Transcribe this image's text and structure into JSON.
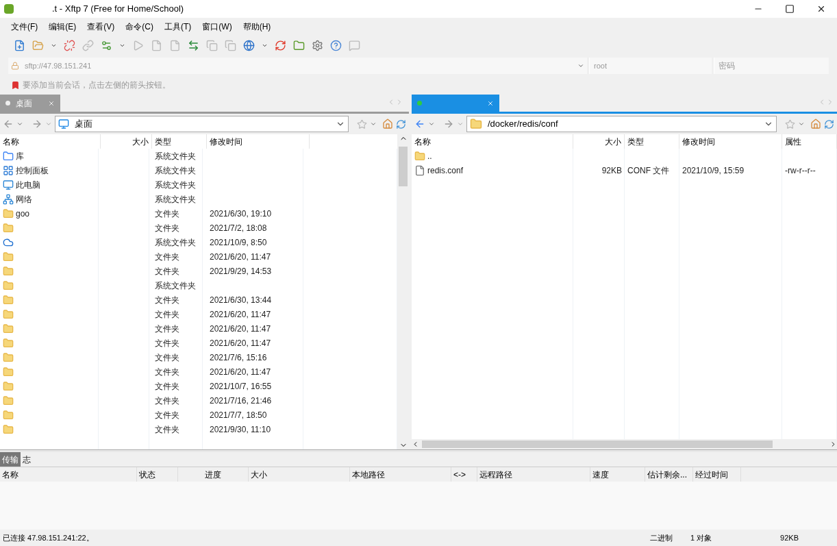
{
  "window": {
    "title": ".t - Xftp 7 (Free for Home/School)"
  },
  "menu": [
    "文件(F)",
    "编辑(E)",
    "查看(V)",
    "命令(C)",
    "工具(T)",
    "窗口(W)",
    "帮助(H)"
  ],
  "address_bar": {
    "host": {
      "placeholder": "sftp://47.98.151.241"
    },
    "user": {
      "placeholder": "root"
    },
    "password": {
      "placeholder": "密码"
    }
  },
  "hint": "要添加当前会话，点击左侧的箭头按钮。",
  "local": {
    "tab": {
      "label": "桌面",
      "selected": false
    },
    "path": "桌面",
    "columns": [
      "名称",
      "大小",
      "类型",
      "修改时间"
    ],
    "rows": [
      {
        "kind": "library",
        "name": "库",
        "type": "系统文件夹"
      },
      {
        "kind": "control",
        "name": "控制面板",
        "type": "系统文件夹"
      },
      {
        "kind": "computer",
        "name": "此电脑",
        "type": "系统文件夹"
      },
      {
        "kind": "network",
        "name": "网络",
        "type": "系统文件夹"
      },
      {
        "kind": "folder",
        "name": "goo",
        "type": "文件夹",
        "modified": "2021/6/30, 19:10"
      },
      {
        "kind": "folder",
        "type": "文件夹",
        "modified": "2021/7/2, 18:08"
      },
      {
        "kind": "cloud",
        "type": "系统文件夹",
        "modified": "2021/10/9, 8:50"
      },
      {
        "kind": "folder",
        "type": "文件夹",
        "modified": "2021/6/20, 11:47"
      },
      {
        "kind": "folder",
        "type": "文件夹",
        "modified": "2021/9/29, 14:53"
      },
      {
        "kind": "folder",
        "type": "系统文件夹"
      },
      {
        "kind": "folder",
        "type": "文件夹",
        "modified": "2021/6/30, 13:44"
      },
      {
        "kind": "folder",
        "type": "文件夹",
        "modified": "2021/6/20, 11:47"
      },
      {
        "kind": "folder",
        "type": "文件夹",
        "modified": "2021/6/20, 11:47"
      },
      {
        "kind": "folder",
        "type": "文件夹",
        "modified": "2021/6/20, 11:47"
      },
      {
        "kind": "folder",
        "type": "文件夹",
        "modified": "2021/7/6, 15:16"
      },
      {
        "kind": "folder",
        "type": "文件夹",
        "modified": "2021/6/20, 11:47"
      },
      {
        "kind": "folder",
        "type": "文件夹",
        "modified": "2021/10/7, 16:55"
      },
      {
        "kind": "folder",
        "type": "文件夹",
        "modified": "2021/7/16, 21:46"
      },
      {
        "kind": "folder",
        "type": "文件夹",
        "modified": "2021/7/7, 18:50"
      },
      {
        "kind": "folder",
        "type": "文件夹",
        "modified": "2021/9/30, 11:10"
      }
    ]
  },
  "remote": {
    "tab": {
      "selected": true
    },
    "path": "/docker/redis/conf",
    "columns": [
      "名称",
      "大小",
      "类型",
      "修改时间",
      "属性"
    ],
    "rows": [
      {
        "kind": "folder",
        "name": ".."
      },
      {
        "kind": "file",
        "name": "redis.conf",
        "size": "92KB",
        "type": "CONF 文件",
        "modified": "2021/10/9, 15:59",
        "attributes": "-rw-r--r--"
      }
    ]
  },
  "transfer": {
    "tabs": [
      {
        "label": "传输",
        "selected": true
      },
      {
        "label": "志",
        "selected": false
      }
    ],
    "columns": [
      "名称",
      "状态",
      "进度",
      "大小",
      "本地路径",
      "<->",
      "远程路径",
      "速度",
      "估计剩余...",
      "经过时间"
    ]
  },
  "status_bar": {
    "connection": "已连接 47.98.151.241:22。",
    "mode": "二进制",
    "objects": "1 对象",
    "size": "92KB"
  }
}
